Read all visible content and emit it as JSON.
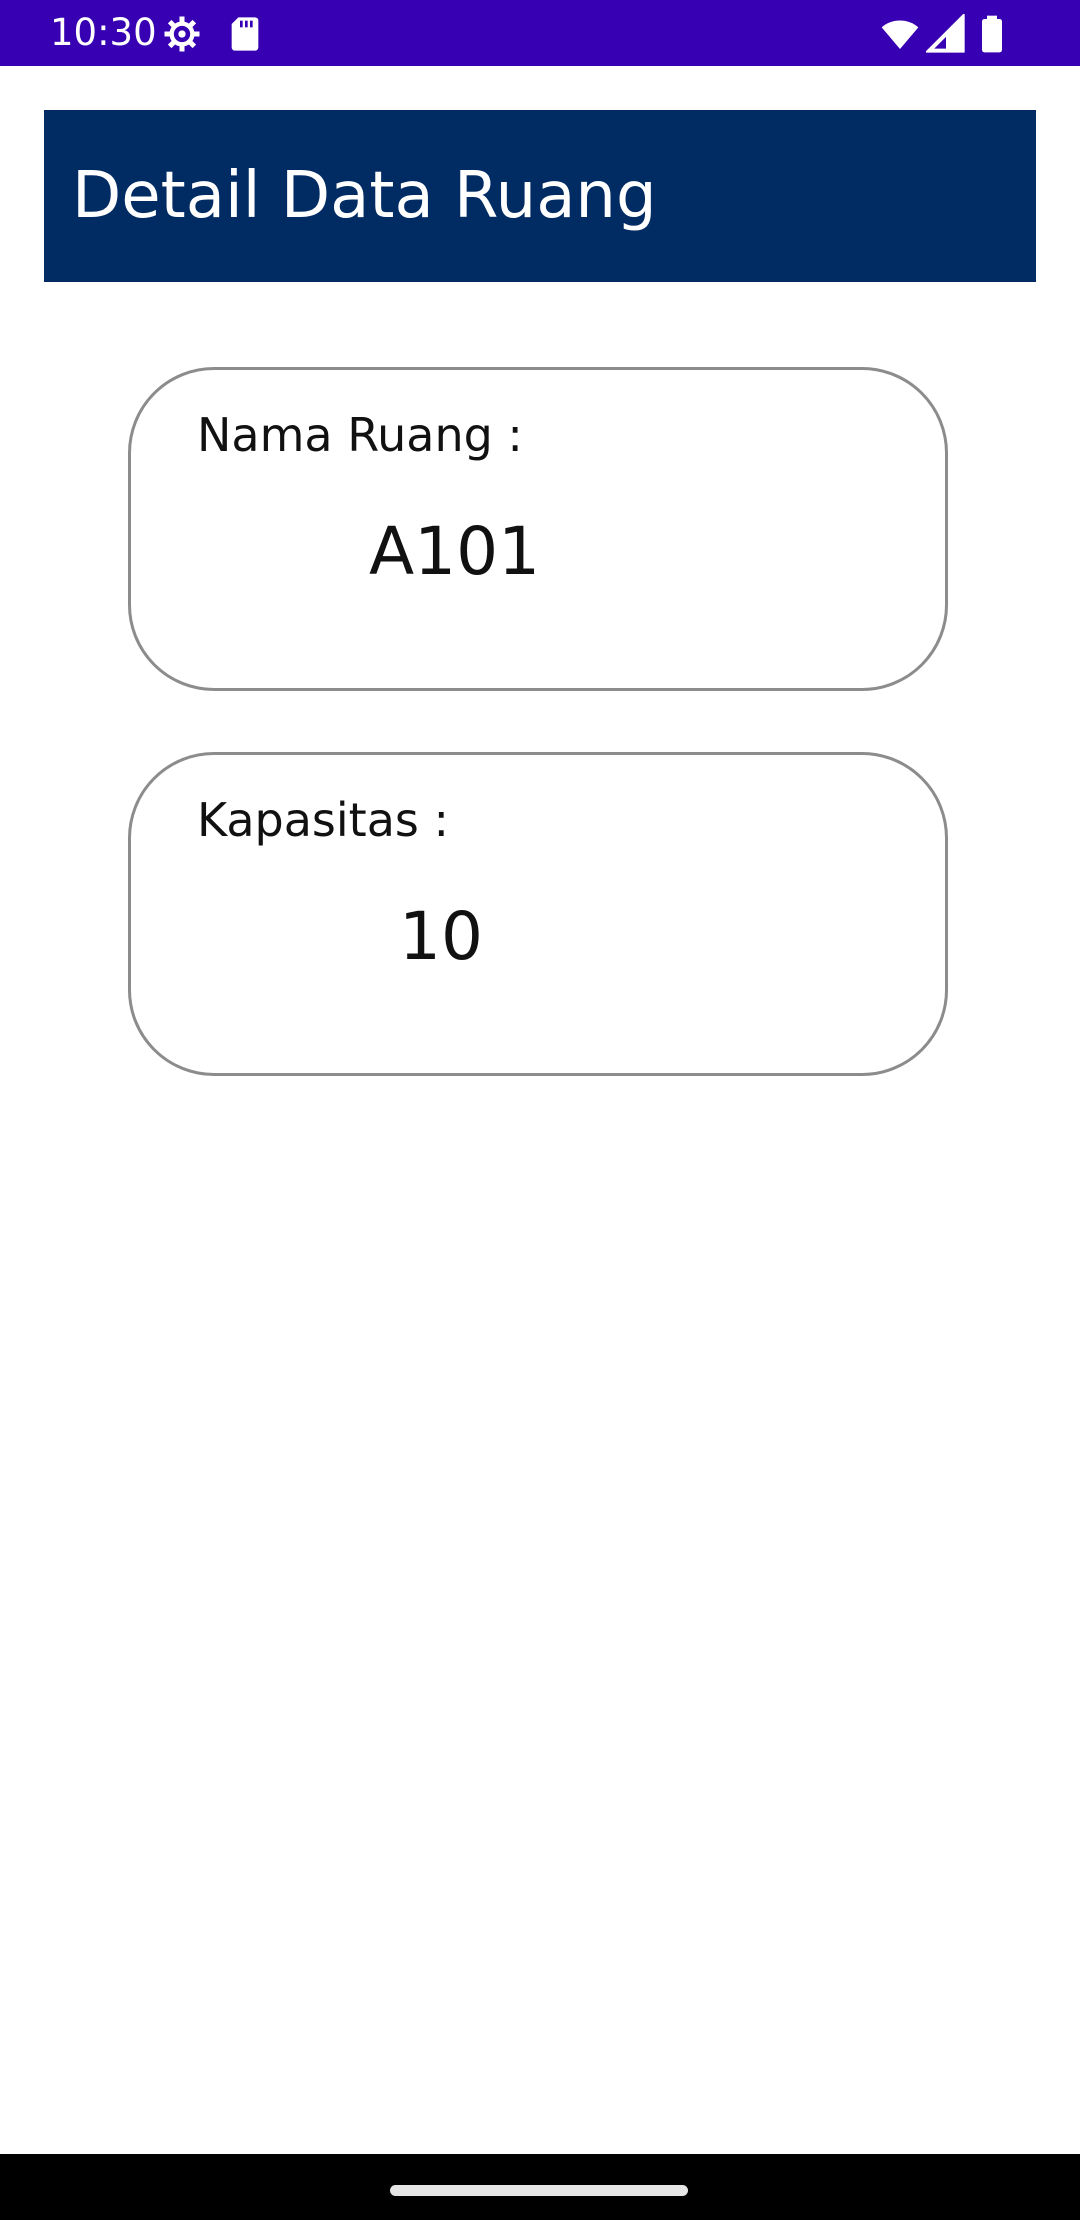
{
  "status_bar": {
    "time": "10:30",
    "icons": [
      "settings-gear-icon",
      "sd-card-icon",
      "wifi-icon",
      "signal-icon",
      "battery-icon"
    ],
    "background": "#3700B3"
  },
  "header": {
    "title": "Detail Data Ruang",
    "background": "#002B63"
  },
  "cards": {
    "nama_ruang": {
      "label": "Nama Ruang :",
      "value": "A101"
    },
    "kapasitas": {
      "label": "Kapasitas :",
      "value": "10"
    }
  },
  "nav_bar": {
    "background": "#000000"
  }
}
